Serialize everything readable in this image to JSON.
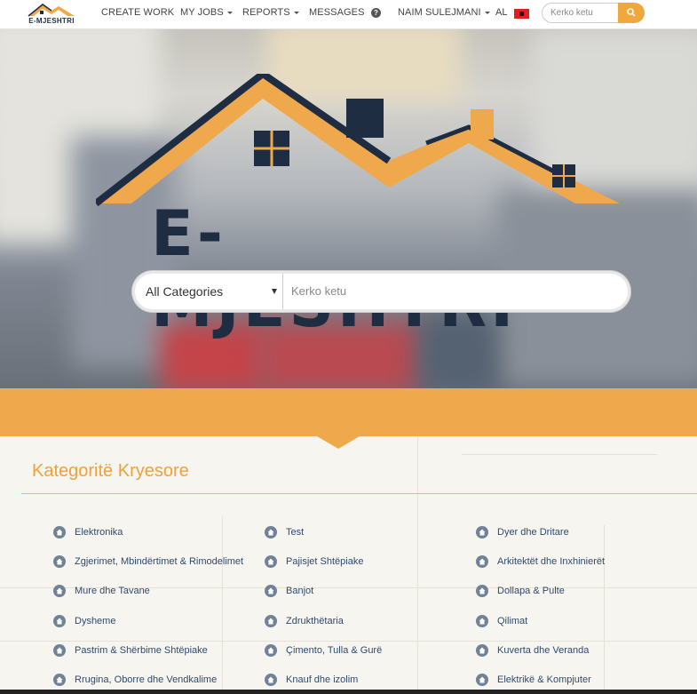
{
  "brand": {
    "logo_text": "E-MJESHTRI"
  },
  "nav": {
    "create_work": "CREATE WORK",
    "my_jobs": "MY JOBS",
    "reports": "REPORTS",
    "messages": "MESSAGES",
    "help_icon": "question-circle-icon",
    "user_name": "NAIM SULEJMANI",
    "language": "AL",
    "search_placeholder": "Kerko ketu",
    "search_icon": "search-icon"
  },
  "hero": {
    "title": "E-MJESHTRI",
    "category_select": "All Categories",
    "search_placeholder": "Kerko ketu"
  },
  "section": {
    "title": "Kategoritë Kryesore"
  },
  "categories": {
    "col1": [
      "Elektronika",
      "Zgjerimet, Mbindërtimet & Rimodelimet",
      "Mure dhe Tavane",
      "Dysheme",
      "Pastrim & Shërbime Shtëpiake",
      "Rrugina, Oborre dhe Vendkalime"
    ],
    "col2": [
      "Test",
      "Pajisjet Shtëpiake",
      "Banjot",
      "Zdrukthëtaria",
      "Çimento, Tulla & Gurë",
      "Knauf dhe izolim"
    ],
    "col3": [
      "Dyer dhe Dritare",
      "Arkitektët dhe Inxhinierët",
      "Dollapa & Pulte",
      "Qilimat",
      "Kuverta dhe Veranda",
      "Elektrikë & Kompjuter"
    ]
  },
  "colors": {
    "accent": "#f0a84c",
    "dark": "#1f2d42",
    "link": "#2f4a6e"
  }
}
